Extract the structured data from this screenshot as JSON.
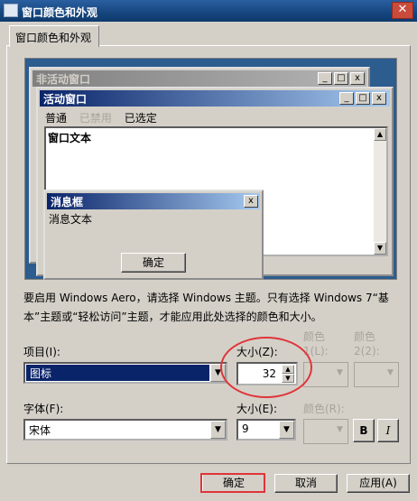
{
  "window": {
    "title": "窗口颜色和外观",
    "close": "✕"
  },
  "tab": {
    "label": "窗口颜色和外观"
  },
  "preview": {
    "inactive_title": "非活动窗口",
    "active_title": "活动窗口",
    "menu": {
      "normal": "普通",
      "disabled": "已禁用",
      "selected": "已选定"
    },
    "window_text": "窗口文本",
    "message_title": "消息框",
    "message_text": "消息文本",
    "ok": "确定",
    "caption_buttons": {
      "min": "_",
      "max": "□",
      "close": "x"
    }
  },
  "info": "要启用 Windows Aero，请选择 Windows 主题。只有选择 Windows 7“基本”主题或“轻松访问”主题，才能应用此处选择的颜色和大小。",
  "item": {
    "label": "项目(I):",
    "value": "图标",
    "size_label": "大小(Z):",
    "size_value": "32",
    "color1_label": "颜色 1(L):",
    "color2_label": "颜色 2(2):"
  },
  "font": {
    "label": "字体(F):",
    "value": "宋体",
    "size_label": "大小(E):",
    "size_value": "9",
    "color_label": "颜色(R):",
    "bold": "B",
    "italic": "I"
  },
  "buttons": {
    "ok": "确定",
    "cancel": "取消",
    "apply": "应用(A)"
  }
}
